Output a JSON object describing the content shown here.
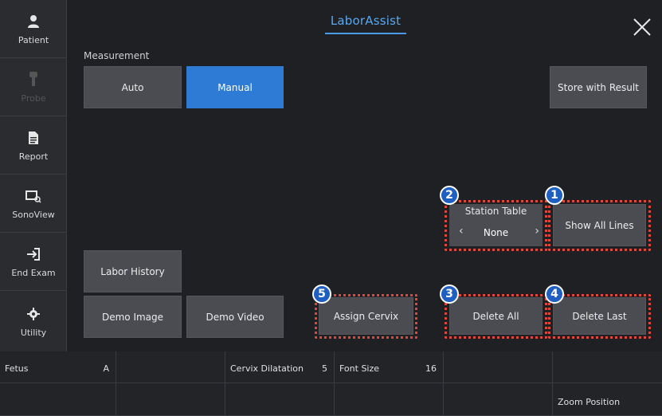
{
  "sidebar": {
    "items": [
      {
        "label": "Patient",
        "icon": "person-icon",
        "enabled": true
      },
      {
        "label": "Probe",
        "icon": "probe-icon",
        "enabled": false
      },
      {
        "label": "Report",
        "icon": "document-icon",
        "enabled": true
      },
      {
        "label": "SonoView",
        "icon": "sonoview-icon",
        "enabled": true
      },
      {
        "label": "End Exam",
        "icon": "end-exam-icon",
        "enabled": true
      },
      {
        "label": "Utility",
        "icon": "gear-icon",
        "enabled": true
      }
    ]
  },
  "header": {
    "title": "LaborAssist",
    "close_icon": "close-icon"
  },
  "measurement": {
    "label": "Measurement",
    "auto": "Auto",
    "manual": "Manual",
    "selected": "Manual"
  },
  "buttons": {
    "store_with_result": "Store with Result",
    "show_all_lines": "Show All Lines",
    "labor_history": "Labor History",
    "demo_image": "Demo Image",
    "demo_video": "Demo Video",
    "assign_cervix": "Assign Cervix",
    "delete_all": "Delete All",
    "delete_last": "Delete Last"
  },
  "station_table": {
    "label": "Station Table",
    "value": "None",
    "prev": "‹",
    "next": "›"
  },
  "callouts": {
    "show_all_lines": "1",
    "station_table": "2",
    "delete_all": "3",
    "delete_last": "4",
    "assign_cervix": "5"
  },
  "bottom": {
    "fetus": {
      "label": "Fetus",
      "value": "A"
    },
    "cervix_dilatation": {
      "label": "Cervix Dilatation",
      "value": "5"
    },
    "font_size": {
      "label": "Font Size",
      "value": "16"
    },
    "zoom_position": {
      "label": "Zoom Position"
    }
  },
  "colors": {
    "accent": "#2e7bd6",
    "title": "#5aa8f0",
    "callout_border": "#e0473a",
    "badge": "#1f5fc2"
  }
}
